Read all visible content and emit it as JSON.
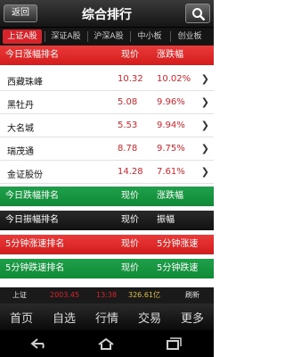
{
  "header": {
    "back_label": "返回",
    "title": "综合排行",
    "search_icon": "search-icon"
  },
  "tabs": [
    "上证A股",
    "深证A股",
    "沪深A股",
    "中小板",
    "创业板"
  ],
  "up_section": {
    "title": "今日涨幅排名",
    "col_price": "现价",
    "col_change": "涨跌幅",
    "rows": [
      {
        "name": "西藏珠峰",
        "price": "10.32",
        "change": "10.02%"
      },
      {
        "name": "黑牡丹",
        "price": "5.08",
        "change": "9.96%"
      },
      {
        "name": "大名城",
        "price": "5.53",
        "change": "9.94%"
      },
      {
        "name": "瑞茂通",
        "price": "8.78",
        "change": "9.75%"
      },
      {
        "name": "金证股份",
        "price": "14.28",
        "change": "7.61%"
      }
    ]
  },
  "down_section": {
    "title": "今日跌幅排名",
    "col_price": "现价",
    "col_change": "涨跌幅"
  },
  "amp_section": {
    "title": "今日振幅排名",
    "col_price": "现价",
    "col_change": "振幅"
  },
  "rise5_section": {
    "title": "5分钟涨速排名",
    "col_price": "现价",
    "col_change": "5分钟涨速"
  },
  "fall5_section": {
    "title": "5分钟跌速排名",
    "col_price": "现价",
    "col_change": "5分钟跌速"
  },
  "index_bar": {
    "name": "上证",
    "value": "2003.45",
    "time": "13:38",
    "amount": "326.61亿",
    "refresh": "刷新"
  },
  "nav": [
    "首页",
    "自选",
    "行情",
    "交易",
    "更多"
  ],
  "colors": {
    "up_red": "#d8232a",
    "green": "#108a36",
    "dark": "#151515"
  }
}
